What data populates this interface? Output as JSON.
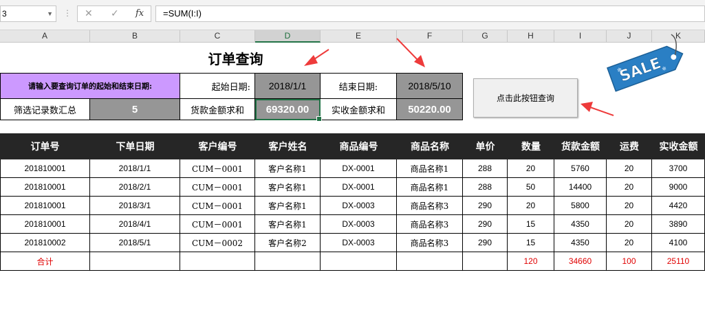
{
  "formula_bar": {
    "name_box": "3",
    "cancel_icon": "✕",
    "enter_icon": "✓",
    "function_icon": "fx",
    "formula": "=SUM(I:I)"
  },
  "columns": [
    "A",
    "B",
    "C",
    "D",
    "E",
    "F",
    "G",
    "H",
    "I",
    "J",
    "K"
  ],
  "selected_column": "D",
  "title": "订单查询",
  "query": {
    "prompt": "请输入要查询订单的起始和结束日期:",
    "start_label": "起始日期:",
    "start_value": "2018/1/1",
    "end_label": "结束日期:",
    "end_value": "2018/5/10",
    "count_label": "筛选记录数汇总",
    "count_value": "5",
    "goods_label": "货款金额求和",
    "goods_value": "69320.00",
    "received_label": "实收金额求和",
    "received_value": "50220.00"
  },
  "button_label": "点击此按钮查询",
  "sale_tag": {
    "text": "SALE",
    "color": "#2a7fc4"
  },
  "accent_color": "#217346",
  "arrow_color": "#ee3b3b",
  "table": {
    "headers": [
      "订单号",
      "下单日期",
      "客户编号",
      "客户姓名",
      "商品编号",
      "商品名称",
      "单价",
      "数量",
      "货款金额",
      "运费",
      "实收金额"
    ],
    "rows": [
      [
        "201810001",
        "2018/1/1",
        "CUM－0001",
        "客户名称1",
        "DX-0001",
        "商品名称1",
        "288",
        "20",
        "5760",
        "20",
        "3700"
      ],
      [
        "201810001",
        "2018/2/1",
        "CUM－0001",
        "客户名称1",
        "DX-0001",
        "商品名称1",
        "288",
        "50",
        "14400",
        "20",
        "9000"
      ],
      [
        "201810001",
        "2018/3/1",
        "CUM－0001",
        "客户名称1",
        "DX-0003",
        "商品名称3",
        "290",
        "20",
        "5800",
        "20",
        "4420"
      ],
      [
        "201810001",
        "2018/4/1",
        "CUM－0001",
        "客户名称1",
        "DX-0003",
        "商品名称3",
        "290",
        "15",
        "4350",
        "20",
        "3890"
      ],
      [
        "201810002",
        "2018/5/1",
        "CUM－0002",
        "客户名称2",
        "DX-0003",
        "商品名称3",
        "290",
        "15",
        "4350",
        "20",
        "4100"
      ]
    ],
    "total": [
      "合计",
      "",
      "",
      "",
      "",
      "",
      "",
      "120",
      "34660",
      "100",
      "25110"
    ]
  }
}
